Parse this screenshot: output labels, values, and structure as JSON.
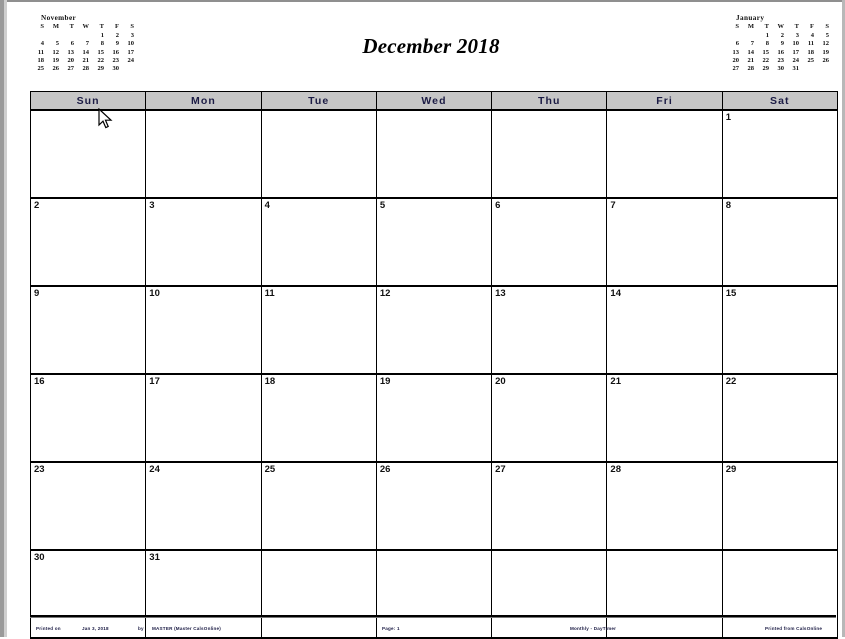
{
  "page": {
    "title": "December 2018",
    "colors": {
      "header_fill": "#c6c6c6",
      "text": "#1b1b44",
      "grid": "#000000",
      "paper": "#ffffff"
    }
  },
  "mini_calendars": [
    {
      "name": "november-mini-calendar",
      "title": "November",
      "dow": [
        "S",
        "M",
        "T",
        "W",
        "T",
        "F",
        "S"
      ],
      "cells": [
        "",
        "",
        "",
        "",
        "1",
        "2",
        "3",
        "4",
        "5",
        "6",
        "7",
        "8",
        "9",
        "10",
        "11",
        "12",
        "13",
        "14",
        "15",
        "16",
        "17",
        "18",
        "19",
        "20",
        "21",
        "22",
        "23",
        "24",
        "25",
        "26",
        "27",
        "28",
        "29",
        "30",
        ""
      ]
    },
    {
      "name": "january-mini-calendar",
      "title": "January",
      "dow": [
        "S",
        "M",
        "T",
        "W",
        "T",
        "F",
        "S"
      ],
      "cells": [
        "",
        "",
        "1",
        "2",
        "3",
        "4",
        "5",
        "6",
        "7",
        "8",
        "9",
        "10",
        "11",
        "12",
        "13",
        "14",
        "15",
        "16",
        "17",
        "18",
        "19",
        "20",
        "21",
        "22",
        "23",
        "24",
        "25",
        "26",
        "27",
        "28",
        "29",
        "30",
        "31",
        "",
        ""
      ]
    }
  ],
  "calendar": {
    "weekday_headers": [
      "Sun",
      "Mon",
      "Tue",
      "Wed",
      "Thu",
      "Fri",
      "Sat"
    ],
    "weeks": [
      [
        "",
        "",
        "",
        "",
        "",
        "",
        "1"
      ],
      [
        "2",
        "3",
        "4",
        "5",
        "6",
        "7",
        "8"
      ],
      [
        "9",
        "10",
        "11",
        "12",
        "13",
        "14",
        "15"
      ],
      [
        "16",
        "17",
        "18",
        "19",
        "20",
        "21",
        "22"
      ],
      [
        "23",
        "24",
        "25",
        "26",
        "27",
        "28",
        "29"
      ],
      [
        "30",
        "31",
        "",
        "",
        "",
        "",
        ""
      ]
    ]
  },
  "footer": {
    "printed_label": "Printed on",
    "printed_date": "Jan 3, 2018",
    "by_label": "by",
    "author": "MASTER (Master CalsOnline)",
    "page": "Page:  1",
    "product": "Monthly - DayTimer",
    "source": "Printed from CalsOnline"
  }
}
